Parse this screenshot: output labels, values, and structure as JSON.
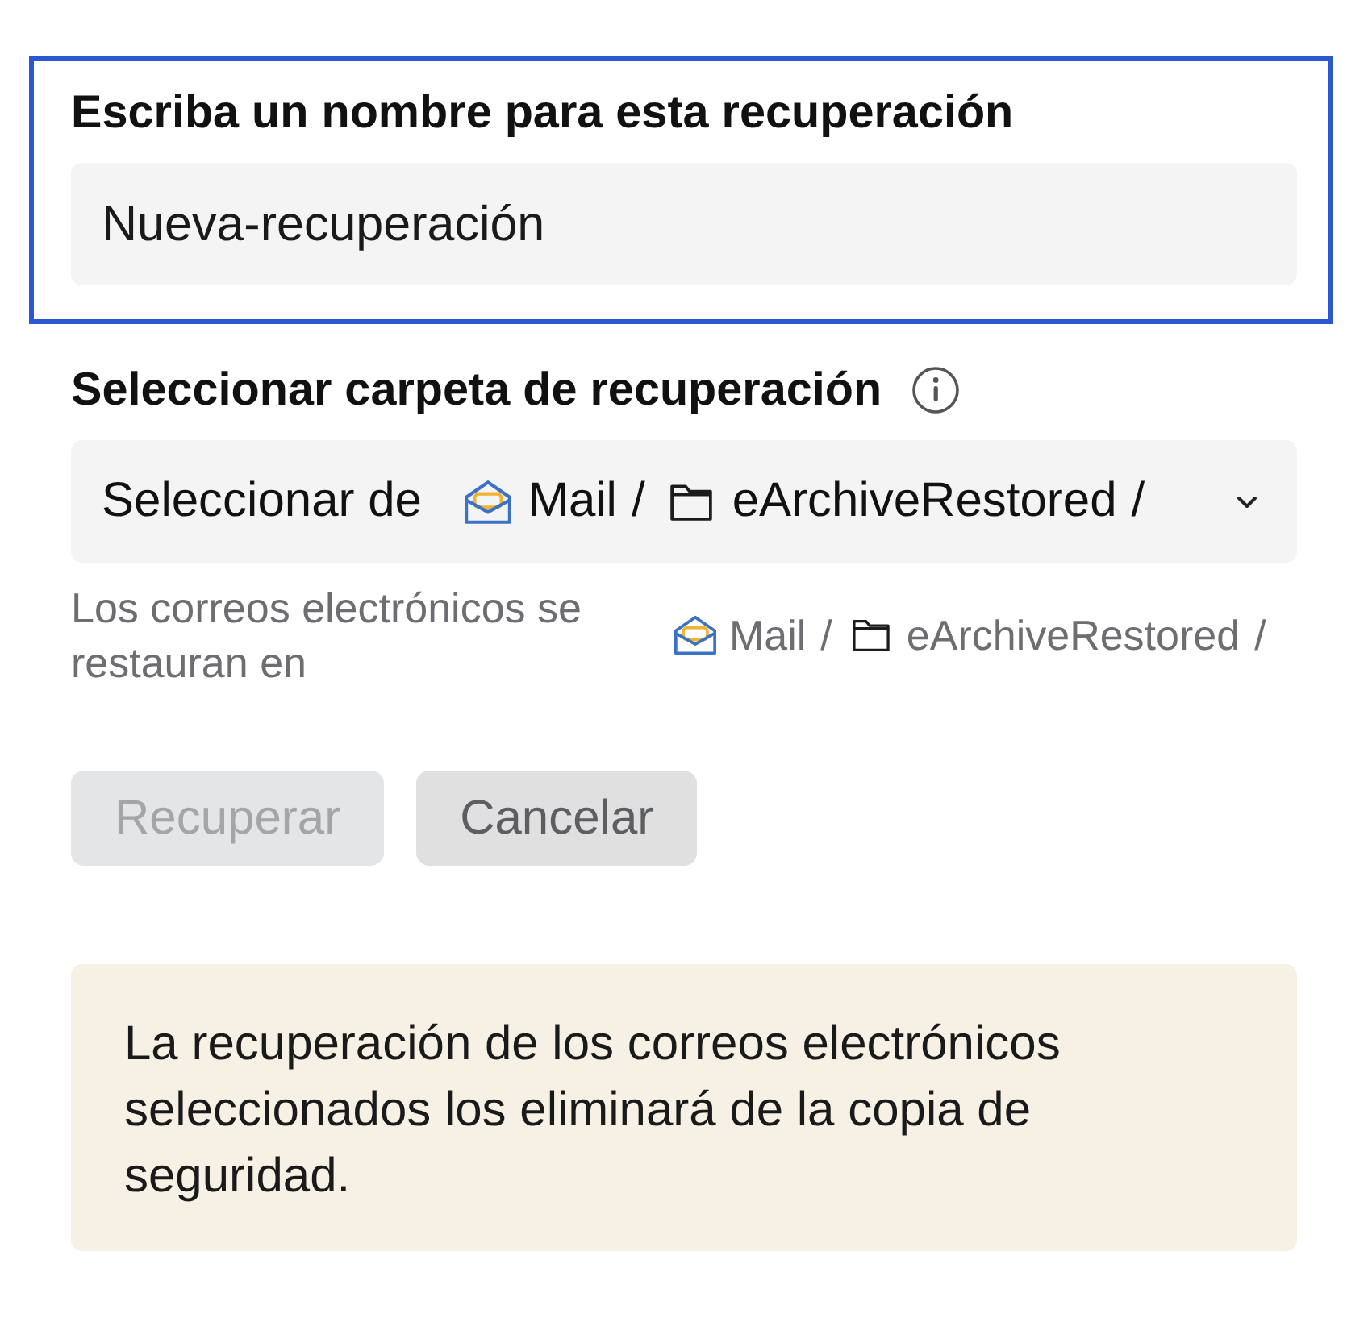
{
  "name_field": {
    "label": "Escriba un nombre para esta recuperación",
    "value": "Nueva-recuperación",
    "focused": true
  },
  "folder_field": {
    "label": "Seleccionar carpeta de recuperación",
    "dropdown": {
      "prefix": "Seleccionar de",
      "path": [
        {
          "kind": "mailbox",
          "label": "Mail",
          "separator": "/"
        },
        {
          "kind": "folder",
          "label": "eArchiveRestored",
          "separator": "/"
        }
      ]
    }
  },
  "destination": {
    "text": "Los correos electrónicos se restauran en",
    "path": [
      {
        "kind": "mailbox",
        "label": "Mail",
        "separator": "/"
      },
      {
        "kind": "folder",
        "label": "eArchiveRestored",
        "separator": "/"
      }
    ]
  },
  "buttons": [
    {
      "label": "Recuperar",
      "disabled": true
    },
    {
      "label": "Cancelar",
      "disabled": false
    }
  ],
  "notice": {
    "text": "La recuperación de los correos electrónicos seleccionados los eliminará de la copia de seguridad."
  }
}
